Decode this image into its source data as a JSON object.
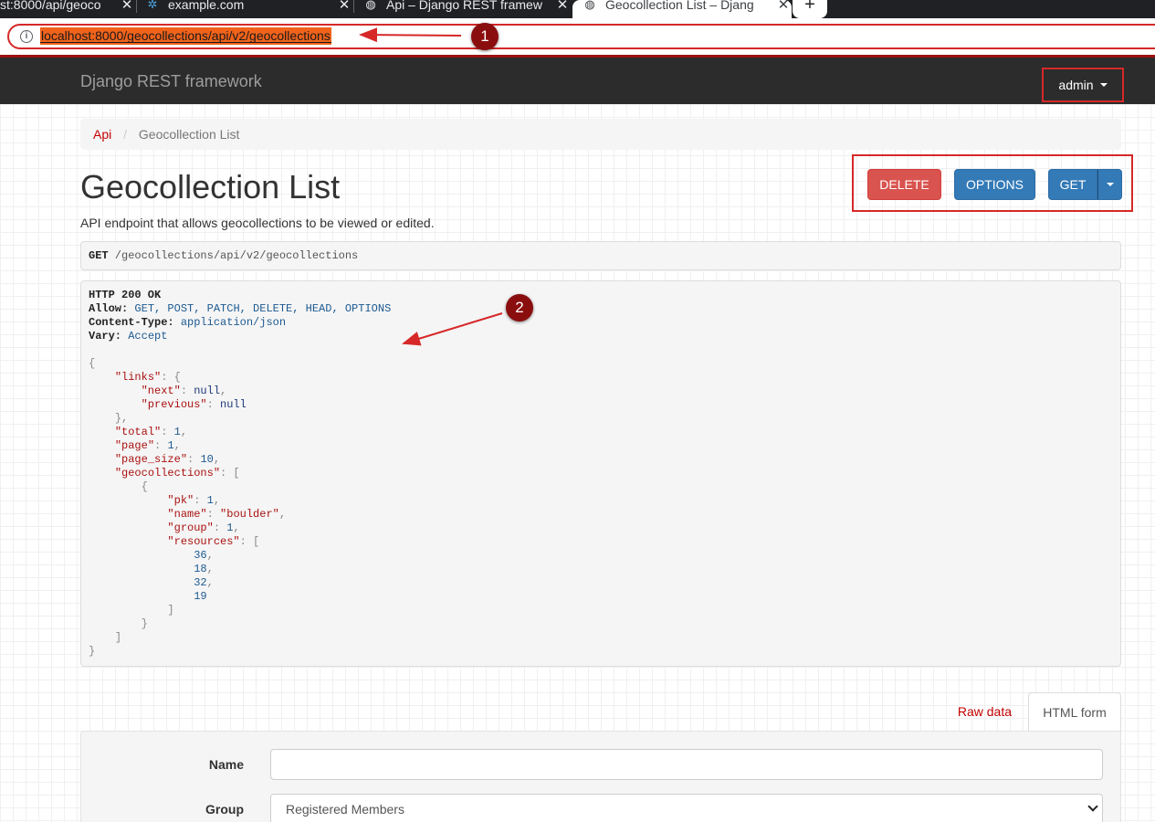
{
  "browser": {
    "tabs": [
      {
        "label": "st:8000/api/geoco",
        "icon": ""
      },
      {
        "label": "example.com",
        "icon": "snowflake-icon"
      },
      {
        "label": "Api – Django REST framew",
        "icon": "globe-icon"
      },
      {
        "label": "Geocollection List – Djang",
        "icon": "globe-icon",
        "active": true
      }
    ],
    "url": "localhost:8000/geocollections/api/v2/geocollections",
    "close_glyph": "✕",
    "new_tab_glyph": "+"
  },
  "navbar": {
    "brand": "Django REST framework",
    "user": "admin"
  },
  "breadcrumb": {
    "items": [
      "Api",
      "Geocollection List"
    ],
    "separator": "/"
  },
  "page": {
    "title": "Geocollection List",
    "description": "API endpoint that allows geocollections to be viewed or edited."
  },
  "actions": {
    "delete": "DELETE",
    "options": "OPTIONS",
    "get": "GET"
  },
  "request": {
    "method": "GET",
    "path": " /geocollections/api/v2/geocollections"
  },
  "response": {
    "status_line": "HTTP 200 OK",
    "headers": [
      {
        "key": "Allow:",
        "value": "GET, POST, PATCH, DELETE, HEAD, OPTIONS"
      },
      {
        "key": "Content-Type:",
        "value": "application/json"
      },
      {
        "key": "Vary:",
        "value": "Accept"
      }
    ],
    "body": {
      "links": {
        "next": "null",
        "previous": "null"
      },
      "total": "1",
      "page": "1",
      "page_size": "10",
      "geocollection": {
        "pk": "1",
        "name": "\"boulder\"",
        "group": "1",
        "resources": [
          "36",
          "18",
          "32",
          "19"
        ]
      }
    }
  },
  "annotations": {
    "marker1": "1",
    "marker2": "2",
    "color": "#d62828"
  },
  "form_tabs": {
    "raw": "Raw data",
    "html": "HTML form"
  },
  "form": {
    "name_label": "Name",
    "name_value": "",
    "group_label": "Group",
    "group_selected": "Registered Members"
  }
}
